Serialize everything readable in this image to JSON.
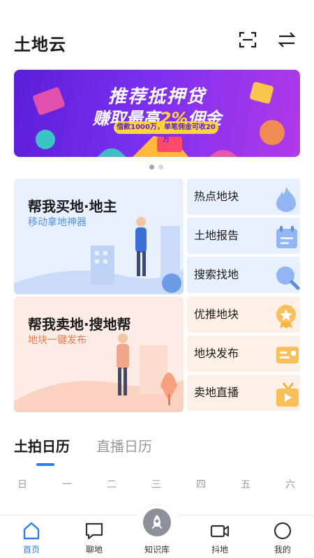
{
  "header": {
    "title": "土地云",
    "scan_icon": "scan-icon",
    "switch_icon": "switch-arrows-icon"
  },
  "banner": {
    "line1": "推荐抵押贷",
    "line2_prefix": "赚取最高",
    "line2_highlight": "2%",
    "line2_suffix": "佣金",
    "pill_text": "借款1000万，单笔佣金可收20万",
    "page_index": 1,
    "page_count": 2
  },
  "cards": {
    "buy": {
      "title": "帮我买地·地主",
      "subtitle": "移动拿地神器"
    },
    "sell": {
      "title": "帮我卖地·搜地帮",
      "subtitle": "地块一键发布"
    }
  },
  "side_items": [
    {
      "label": "热点地块",
      "icon": "flame-icon"
    },
    {
      "label": "土地报告",
      "icon": "calendar-report-icon"
    },
    {
      "label": "搜索找地",
      "icon": "search-icon"
    },
    {
      "label": "优推地块",
      "icon": "star-badge-icon"
    },
    {
      "label": "地块发布",
      "icon": "card-publish-icon"
    },
    {
      "label": "卖地直播",
      "icon": "tv-live-icon"
    }
  ],
  "tabs": [
    {
      "label": "土拍日历",
      "active": true
    },
    {
      "label": "直播日历",
      "active": false
    }
  ],
  "weekdays": [
    "日",
    "一",
    "二",
    "三",
    "四",
    "五",
    "六"
  ],
  "bottom_nav": [
    {
      "label": "首页",
      "icon": "home-icon",
      "active": true
    },
    {
      "label": "聊地",
      "icon": "chat-icon",
      "active": false
    },
    {
      "label": "知识库",
      "icon": "rocket-icon",
      "active": false
    },
    {
      "label": "抖地",
      "icon": "video-icon",
      "active": false
    },
    {
      "label": "我的",
      "icon": "profile-icon",
      "active": false
    }
  ],
  "colors": {
    "accent": "#2f7dea",
    "buy_bg": "#e8f0fd",
    "sell_bg": "#fdece6",
    "banner_purple": "#7b2ff0"
  }
}
